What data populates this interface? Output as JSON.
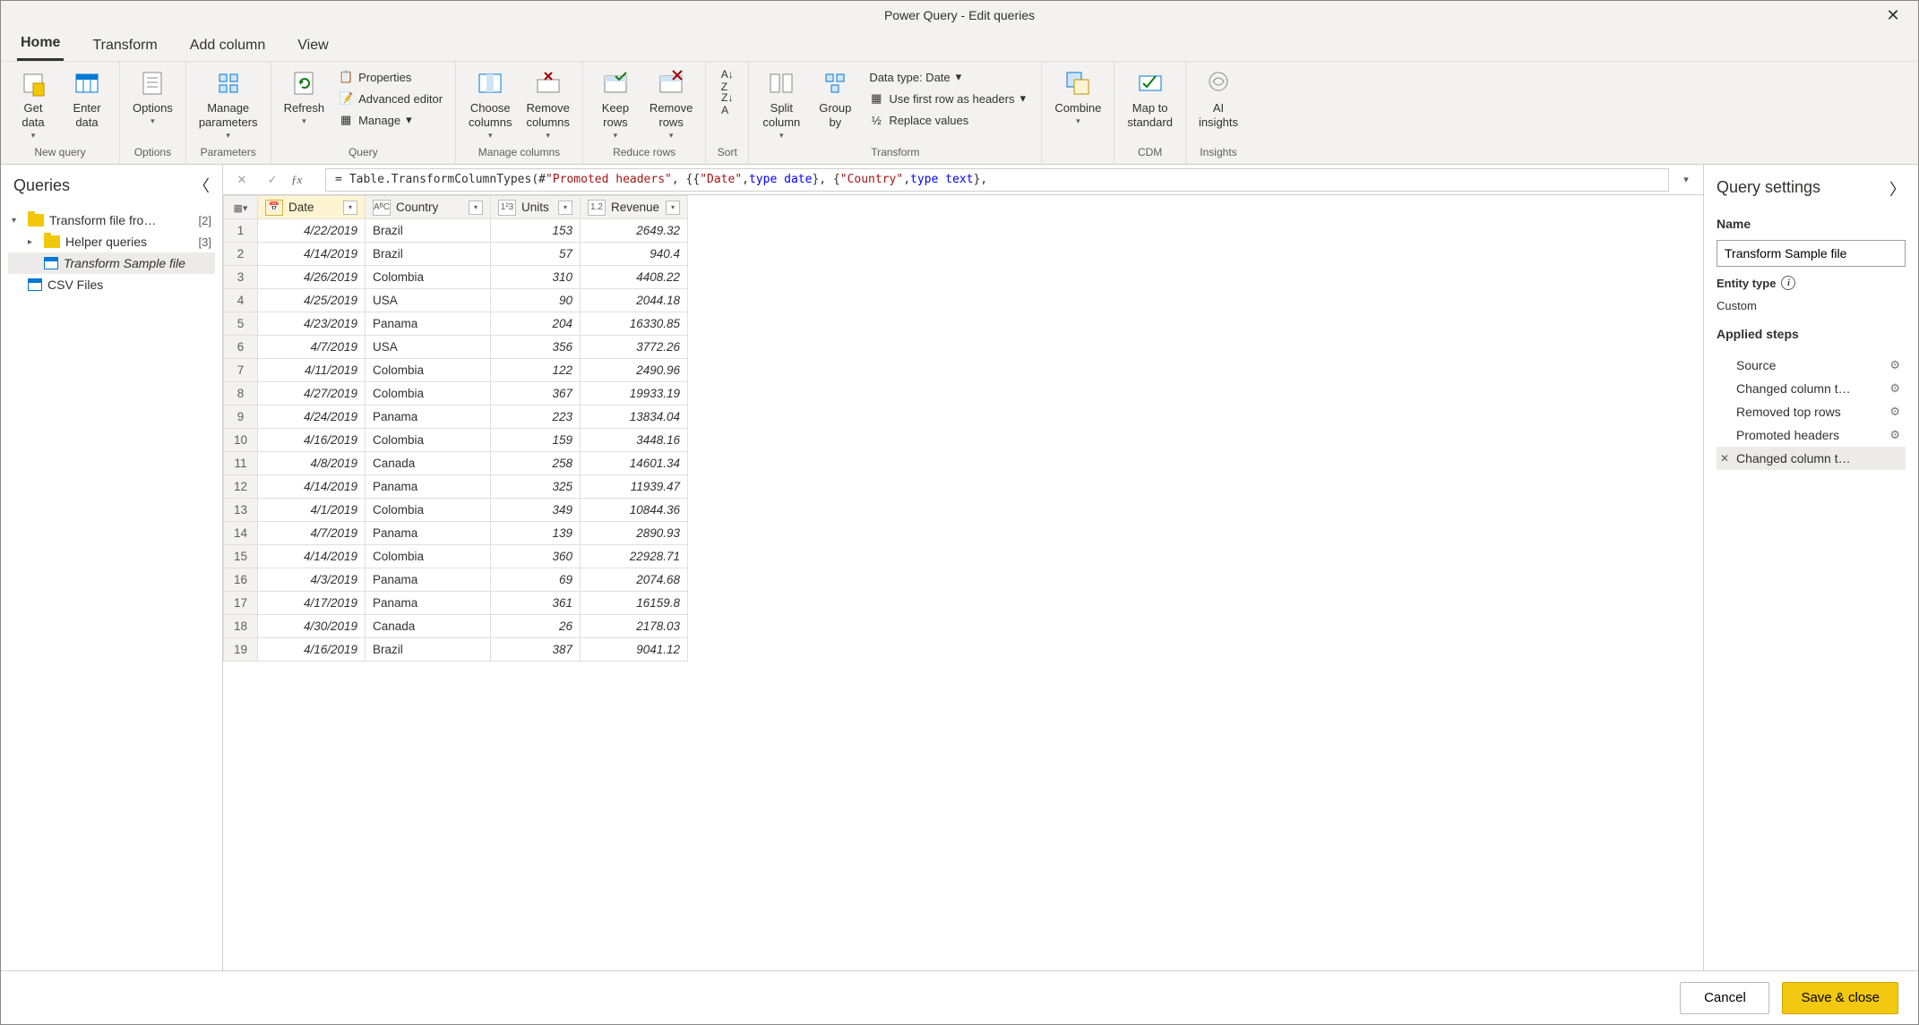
{
  "window": {
    "title": "Power Query - Edit queries"
  },
  "tabs": [
    "Home",
    "Transform",
    "Add column",
    "View"
  ],
  "active_tab": "Home",
  "ribbon": {
    "new_query": {
      "label": "New query",
      "get_data": "Get\ndata",
      "enter_data": "Enter\ndata"
    },
    "options": {
      "label": "Options",
      "options": "Options"
    },
    "parameters": {
      "label": "Parameters",
      "manage": "Manage\nparameters"
    },
    "query": {
      "label": "Query",
      "refresh": "Refresh",
      "properties": "Properties",
      "advanced": "Advanced editor",
      "manage": "Manage"
    },
    "manage_cols": {
      "label": "Manage columns",
      "choose": "Choose\ncolumns",
      "remove": "Remove\ncolumns"
    },
    "reduce": {
      "label": "Reduce rows",
      "keep": "Keep\nrows",
      "remove": "Remove\nrows"
    },
    "sort": {
      "label": "Sort"
    },
    "transform": {
      "label": "Transform",
      "split": "Split\ncolumn",
      "group": "Group\nby",
      "datatype": "Data type: Date",
      "firstrow": "Use first row as headers",
      "replace": "Replace values"
    },
    "combine": {
      "label": "",
      "combine": "Combine"
    },
    "cdm": {
      "label": "CDM",
      "map": "Map to\nstandard"
    },
    "insights": {
      "label": "Insights",
      "ai": "AI\ninsights"
    }
  },
  "queries": {
    "header": "Queries",
    "items": [
      {
        "name": "Transform file fro…",
        "count": "[2]",
        "type": "folder",
        "expanded": true,
        "indent": 0
      },
      {
        "name": "Helper queries",
        "count": "[3]",
        "type": "folder",
        "expanded": false,
        "indent": 1
      },
      {
        "name": "Transform Sample file",
        "type": "query",
        "selected": true,
        "indent": 1
      },
      {
        "name": "CSV Files",
        "type": "query",
        "indent": 0
      }
    ]
  },
  "formula": {
    "prefix": "=",
    "fn_open": "Table.TransformColumnTypes(#",
    "arg1": "\"Promoted headers\"",
    "mid1": ", {{",
    "s_date": "\"Date\"",
    "c1": ", ",
    "kw1": "type date",
    "mid2": "}, {",
    "s_country": "\"Country\"",
    "c2": ", ",
    "kw2": "type text",
    "mid3": "},"
  },
  "columns": [
    {
      "name": "Date",
      "type_icon": "📅",
      "selected": true
    },
    {
      "name": "Country",
      "type_icon": "AᴮC"
    },
    {
      "name": "Units",
      "type_icon": "1²3"
    },
    {
      "name": "Revenue",
      "type_icon": "1.2"
    }
  ],
  "rows": [
    {
      "n": 1,
      "date": "4/22/2019",
      "country": "Brazil",
      "units": 153,
      "revenue": "2649.32"
    },
    {
      "n": 2,
      "date": "4/14/2019",
      "country": "Brazil",
      "units": 57,
      "revenue": "940.4"
    },
    {
      "n": 3,
      "date": "4/26/2019",
      "country": "Colombia",
      "units": 310,
      "revenue": "4408.22"
    },
    {
      "n": 4,
      "date": "4/25/2019",
      "country": "USA",
      "units": 90,
      "revenue": "2044.18"
    },
    {
      "n": 5,
      "date": "4/23/2019",
      "country": "Panama",
      "units": 204,
      "revenue": "16330.85"
    },
    {
      "n": 6,
      "date": "4/7/2019",
      "country": "USA",
      "units": 356,
      "revenue": "3772.26"
    },
    {
      "n": 7,
      "date": "4/11/2019",
      "country": "Colombia",
      "units": 122,
      "revenue": "2490.96"
    },
    {
      "n": 8,
      "date": "4/27/2019",
      "country": "Colombia",
      "units": 367,
      "revenue": "19933.19"
    },
    {
      "n": 9,
      "date": "4/24/2019",
      "country": "Panama",
      "units": 223,
      "revenue": "13834.04"
    },
    {
      "n": 10,
      "date": "4/16/2019",
      "country": "Colombia",
      "units": 159,
      "revenue": "3448.16"
    },
    {
      "n": 11,
      "date": "4/8/2019",
      "country": "Canada",
      "units": 258,
      "revenue": "14601.34"
    },
    {
      "n": 12,
      "date": "4/14/2019",
      "country": "Panama",
      "units": 325,
      "revenue": "11939.47"
    },
    {
      "n": 13,
      "date": "4/1/2019",
      "country": "Colombia",
      "units": 349,
      "revenue": "10844.36"
    },
    {
      "n": 14,
      "date": "4/7/2019",
      "country": "Panama",
      "units": 139,
      "revenue": "2890.93"
    },
    {
      "n": 15,
      "date": "4/14/2019",
      "country": "Colombia",
      "units": 360,
      "revenue": "22928.71"
    },
    {
      "n": 16,
      "date": "4/3/2019",
      "country": "Panama",
      "units": 69,
      "revenue": "2074.68"
    },
    {
      "n": 17,
      "date": "4/17/2019",
      "country": "Panama",
      "units": 361,
      "revenue": "16159.8"
    },
    {
      "n": 18,
      "date": "4/30/2019",
      "country": "Canada",
      "units": 26,
      "revenue": "2178.03"
    },
    {
      "n": 19,
      "date": "4/16/2019",
      "country": "Brazil",
      "units": 387,
      "revenue": "9041.12"
    }
  ],
  "settings": {
    "header": "Query settings",
    "name_label": "Name",
    "name_value": "Transform Sample file",
    "entity_label": "Entity type",
    "entity_value": "Custom",
    "steps_label": "Applied steps",
    "steps": [
      {
        "name": "Source",
        "gear": true
      },
      {
        "name": "Changed column t…",
        "gear": true
      },
      {
        "name": "Removed top rows",
        "gear": true
      },
      {
        "name": "Promoted headers",
        "gear": true
      },
      {
        "name": "Changed column t…",
        "selected": true
      }
    ]
  },
  "footer": {
    "cancel": "Cancel",
    "save": "Save & close"
  }
}
